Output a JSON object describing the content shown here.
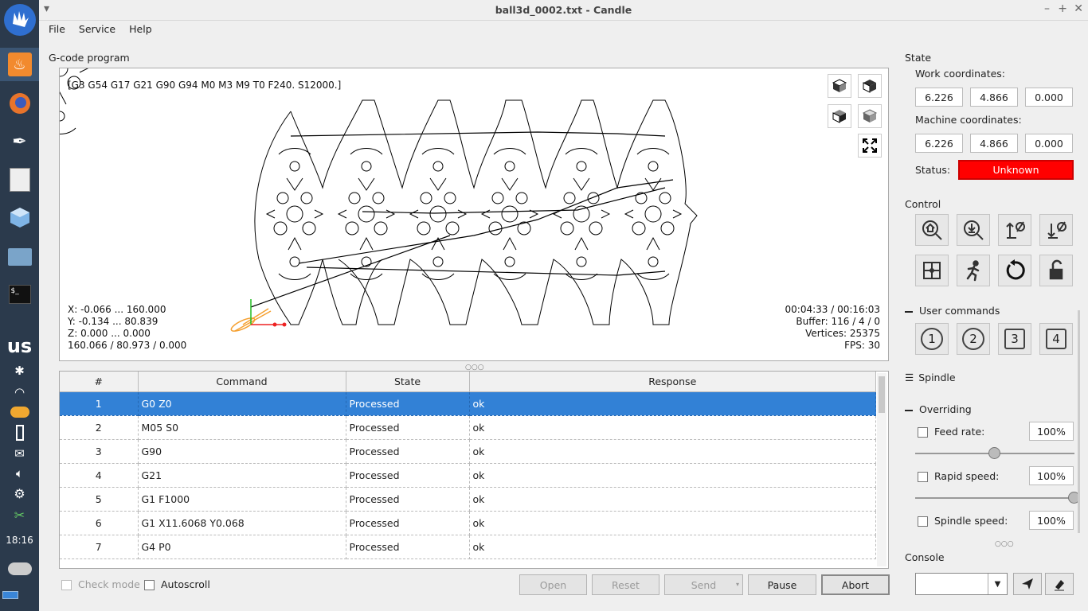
{
  "window": {
    "title": "ball3d_0002.txt - Candle"
  },
  "menu": [
    "File",
    "Service",
    "Help"
  ],
  "gcode_title": "G-code program",
  "visualizer": {
    "state_line": "[G3 G54 G17 G21 G90 G94 M0 M3 M9 T0 F240. S12000.]",
    "x_range": "X: -0.066 ... 160.000",
    "y_range": "Y: -0.134 ... 80.839",
    "z_range": "Z: 0.000 ... 0.000",
    "size": "160.066 / 80.973 / 0.000",
    "time": "00:04:33 / 00:16:03",
    "buffer": "Buffer: 116 / 4 / 0",
    "vertices": "Vertices: 25375",
    "fps": "FPS: 30"
  },
  "table": {
    "headers": [
      "#",
      "Command",
      "State",
      "Response"
    ],
    "rows": [
      [
        "1",
        "G0 Z0",
        "Processed",
        "ok"
      ],
      [
        "2",
        "M05 S0",
        "Processed",
        "ok"
      ],
      [
        "3",
        "G90",
        "Processed",
        "ok"
      ],
      [
        "4",
        "G21",
        "Processed",
        "ok"
      ],
      [
        "5",
        "G1 F1000",
        "Processed",
        "ok"
      ],
      [
        "6",
        "G1  X11.6068 Y0.068",
        "Processed",
        "ok"
      ],
      [
        "7",
        "G4 P0",
        "Processed",
        "ok"
      ]
    ]
  },
  "bottom": {
    "check_mode": "Check mode",
    "autoscroll": "Autoscroll",
    "open": "Open",
    "reset": "Reset",
    "send": "Send",
    "pause": "Pause",
    "abort": "Abort"
  },
  "state": {
    "title": "State",
    "work_label": "Work coordinates:",
    "work": [
      "6.226",
      "4.866",
      "0.000"
    ],
    "machine_label": "Machine coordinates:",
    "machine": [
      "6.226",
      "4.866",
      "0.000"
    ],
    "status_label": "Status:",
    "status": "Unknown",
    "status_color": "#ff0000"
  },
  "control_title": "Control",
  "user_commands": {
    "title": "User commands",
    "buttons": [
      "1",
      "2",
      "3",
      "4"
    ]
  },
  "spindle_title": "Spindle",
  "overriding": {
    "title": "Overriding",
    "feed": {
      "label": "Feed rate:",
      "value": "100%",
      "level": 0.5
    },
    "rapid": {
      "label": "Rapid speed:",
      "value": "100%",
      "level": 1.0
    },
    "spindle": {
      "label": "Spindle speed:",
      "value": "100%"
    }
  },
  "console_title": "Console",
  "taskbar": {
    "clock": "18:16",
    "lang": "us"
  }
}
